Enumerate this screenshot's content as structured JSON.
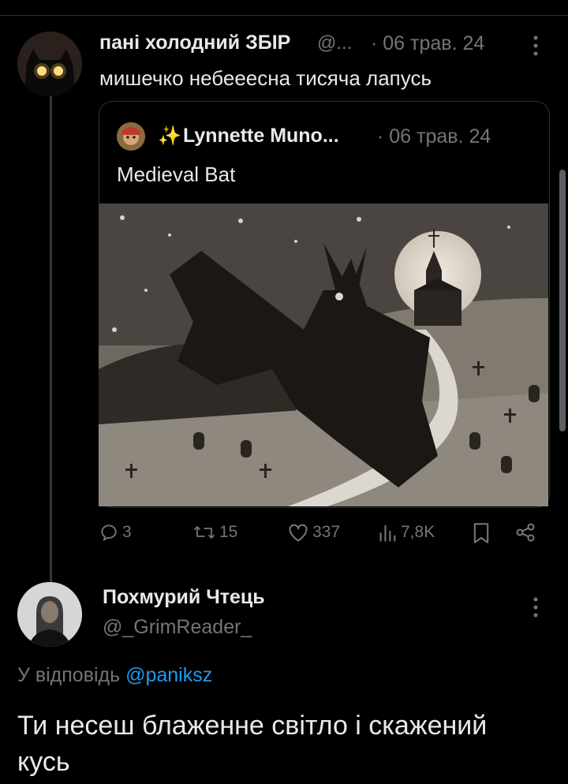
{
  "post": {
    "display_name": "пані холодний ЗБІР",
    "handle": "@...",
    "date": "· 06 трав. 24",
    "text": "мишечко небееесна тисяча лапусь",
    "avatar_icon": "black-cat-avatar",
    "quoted": {
      "display_name_prefix": "✨",
      "display_name": "Lynnette Muno...",
      "date": "· 06 трав. 24",
      "text": "Medieval Bat",
      "avatar_icon": "cartoon-avatar",
      "image_icon": "medieval-bat-illustration"
    },
    "actions": {
      "replies": "3",
      "reposts": "15",
      "likes": "337",
      "views": "7,8K"
    }
  },
  "reply": {
    "display_name": "Похмурий Чтець",
    "handle": "@_GrimReader_",
    "reply_to_prefix": "У відповідь",
    "reply_to_mention": "@paniksz",
    "text": "Ти несеш блаженне світло і скажений кусь",
    "avatar_icon": "person-avatar"
  },
  "colors": {
    "background": "#000000",
    "text": "#e7e9ea",
    "muted": "#71767b",
    "link": "#1d9bf0",
    "divider": "#2f3336"
  }
}
